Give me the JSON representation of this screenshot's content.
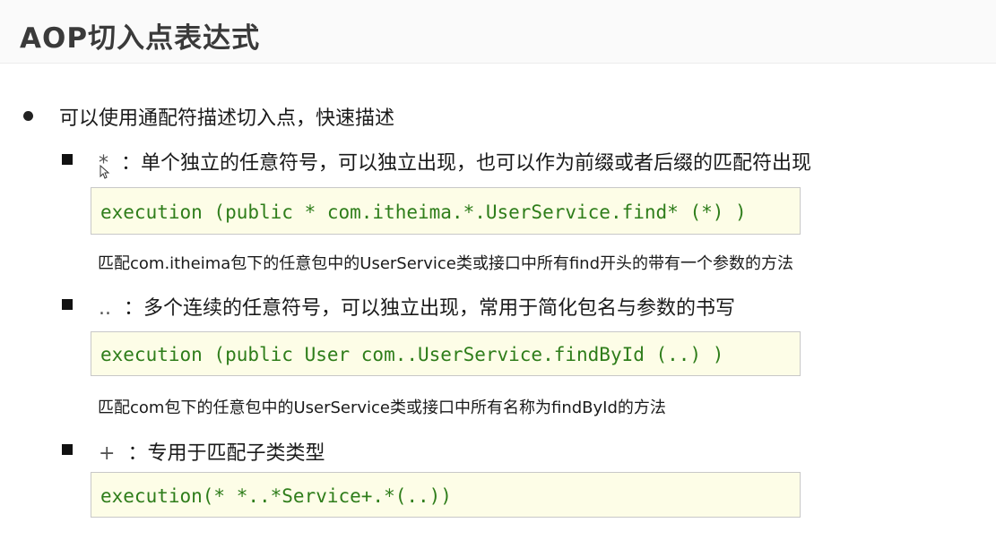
{
  "slide": {
    "title": "AOP切入点表达式",
    "bullet": "可以使用通配符描述切入点，快速描述",
    "items": [
      {
        "symbol": "*",
        "text": "：单个独立的任意符号，可以独立出现，也可以作为前缀或者后缀的匹配符出现",
        "code": "execution (public * com.itheima.*.UserService.find* (*) )",
        "description": "匹配com.itheima包下的任意包中的UserService类或接口中所有find开头的带有一个参数的方法"
      },
      {
        "symbol": "..",
        "text": "：多个连续的任意符号，可以独立出现，常用于简化包名与参数的书写",
        "code": "execution (public User com..UserService.findById (..) )",
        "description": "匹配com包下的任意包中的UserService类或接口中所有名称为findById的方法"
      },
      {
        "symbol": "+",
        "text": "：专用于匹配子类类型",
        "code": "execution(* *..*Service+.*(..))"
      }
    ]
  }
}
